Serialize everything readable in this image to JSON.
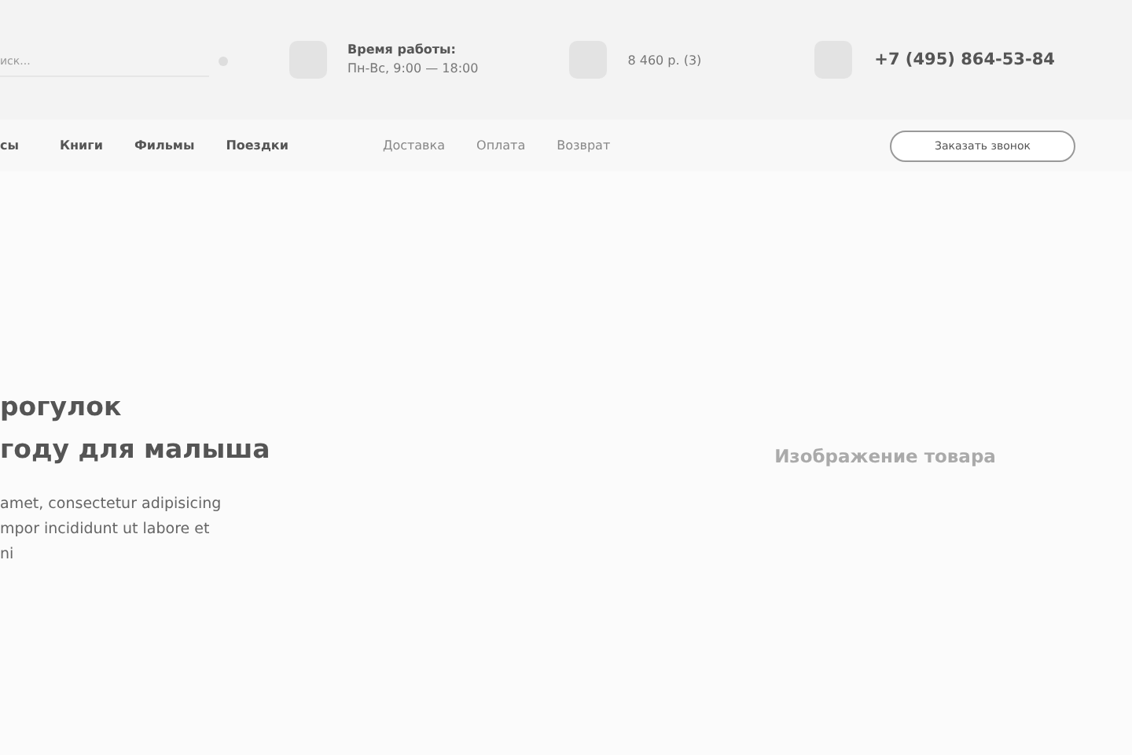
{
  "header": {
    "search": {
      "placeholder": "иск..."
    },
    "hours": {
      "title": "Время работы:",
      "value": "Пн-Вс, 9:00 — 18:00"
    },
    "cart": {
      "text": "8 460 р. (3)"
    },
    "phone": "+7 (495) 864-53-84"
  },
  "nav": {
    "categories": [
      "сы",
      "Книги",
      "Фильмы",
      "Поездки"
    ],
    "links": [
      "Доставка",
      "Оплата",
      "Возврат"
    ],
    "callback_button": "Заказать звонок"
  },
  "hero": {
    "title_lines": [
      "рогулок",
      "году для малыша"
    ],
    "text_lines": [
      "amet, consectetur adipisicing",
      "mpor incididunt ut labore et",
      "ni"
    ],
    "image_label": "Изображение товара"
  }
}
